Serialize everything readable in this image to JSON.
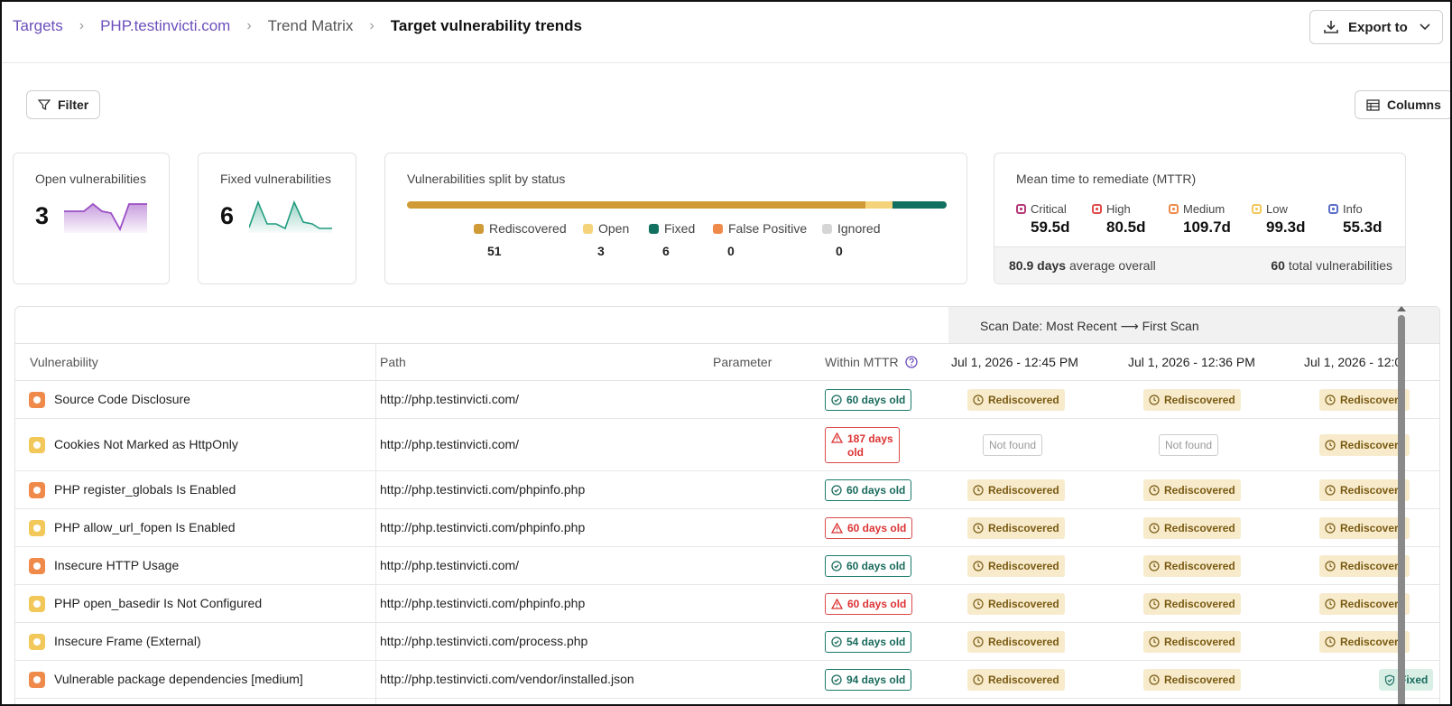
{
  "breadcrumb": {
    "items": [
      "Targets",
      "PHP.testinvicti.com",
      "Trend Matrix"
    ],
    "current": "Target vulnerability trends"
  },
  "toolbar": {
    "export_label": "Export to",
    "filter_label": "Filter",
    "columns_label": "Columns"
  },
  "cards": {
    "open": {
      "title": "Open vulnerabilities",
      "value": "3",
      "color": "#9b4fc4"
    },
    "fixed": {
      "title": "Fixed vulnerabilities",
      "value": "6",
      "color": "#1e9c7e"
    },
    "split": {
      "title": "Vulnerabilities split by status",
      "items": [
        {
          "label": "Rediscovered",
          "value": "51",
          "color": "#d09a37"
        },
        {
          "label": "Open",
          "value": "3",
          "color": "#f4d37a"
        },
        {
          "label": "Fixed",
          "value": "6",
          "color": "#11705f"
        },
        {
          "label": "False Positive",
          "value": "0",
          "color": "#f08a4b"
        },
        {
          "label": "Ignored",
          "value": "0",
          "color": "#d6d6d6"
        }
      ]
    },
    "mttr": {
      "title": "Mean time to remediate (MTTR)",
      "items": [
        {
          "label": "Critical",
          "value": "59.5d",
          "color": "#b43a7a"
        },
        {
          "label": "High",
          "value": "80.5d",
          "color": "#e04b4b"
        },
        {
          "label": "Medium",
          "value": "109.7d",
          "color": "#ef8a4b"
        },
        {
          "label": "Low",
          "value": "99.3d",
          "color": "#f3c85a"
        },
        {
          "label": "Info",
          "value": "55.3d",
          "color": "#5b6fc8"
        }
      ],
      "avg_value": "80.9 days",
      "avg_suffix": "average overall",
      "total_value": "60",
      "total_suffix": "total vulnerabilities"
    }
  },
  "table": {
    "scan_header": "Scan Date: Most Recent ⟶ First Scan",
    "columns": [
      "Vulnerability",
      "Path",
      "Parameter",
      "Within MTTR",
      "Jul 1, 2026 - 12:45 PM",
      "Jul 1, 2026 - 12:36 PM",
      "Jul 1, 2026 - 12:0"
    ],
    "rows": [
      {
        "sev": "#ef8a4b",
        "name": "Source Code Disclosure",
        "path": "http://php.testinvicti.com/",
        "mttr": "60 days old",
        "ok": true,
        "s1": "Rediscovered",
        "s2": "Rediscovered",
        "s3": "Rediscovere"
      },
      {
        "sev": "#f3c85a",
        "name": "Cookies Not Marked as HttpOnly",
        "path": "http://php.testinvicti.com/",
        "mttr_a": "187 days",
        "mttr_b": "old",
        "ok": false,
        "s1": "Not found",
        "s2": "Not found",
        "s3": "Rediscovere"
      },
      {
        "sev": "#ef8a4b",
        "name": "PHP register_globals Is Enabled",
        "path": "http://php.testinvicti.com/phpinfo.php",
        "mttr": "60 days old",
        "ok": true,
        "s1": "Rediscovered",
        "s2": "Rediscovered",
        "s3": "Rediscovere"
      },
      {
        "sev": "#f3c85a",
        "name": "PHP allow_url_fopen Is Enabled",
        "path": "http://php.testinvicti.com/phpinfo.php",
        "mttr": "60 days old",
        "ok": false,
        "s1": "Rediscovered",
        "s2": "Rediscovered",
        "s3": "Rediscovere"
      },
      {
        "sev": "#ef8a4b",
        "name": "Insecure HTTP Usage",
        "path": "http://php.testinvicti.com/",
        "mttr": "60 days old",
        "ok": true,
        "s1": "Rediscovered",
        "s2": "Rediscovered",
        "s3": "Rediscovere"
      },
      {
        "sev": "#f3c85a",
        "name": "PHP open_basedir Is Not Configured",
        "path": "http://php.testinvicti.com/phpinfo.php",
        "mttr": "60 days old",
        "ok": false,
        "s1": "Rediscovered",
        "s2": "Rediscovered",
        "s3": "Rediscovere"
      },
      {
        "sev": "#f3c85a",
        "name": "Insecure Frame (External)",
        "path": "http://php.testinvicti.com/process.php",
        "mttr": "54 days old",
        "ok": true,
        "s1": "Rediscovered",
        "s2": "Rediscovered",
        "s3": "Rediscovere"
      },
      {
        "sev": "#ef8a4b",
        "name": "Vulnerable package dependencies [medium]",
        "path": "http://php.testinvicti.com/vendor/installed.json",
        "mttr": "94 days old",
        "ok": true,
        "s1": "Rediscovered",
        "s2": "Rediscovered",
        "s3": "Fixed"
      }
    ]
  }
}
